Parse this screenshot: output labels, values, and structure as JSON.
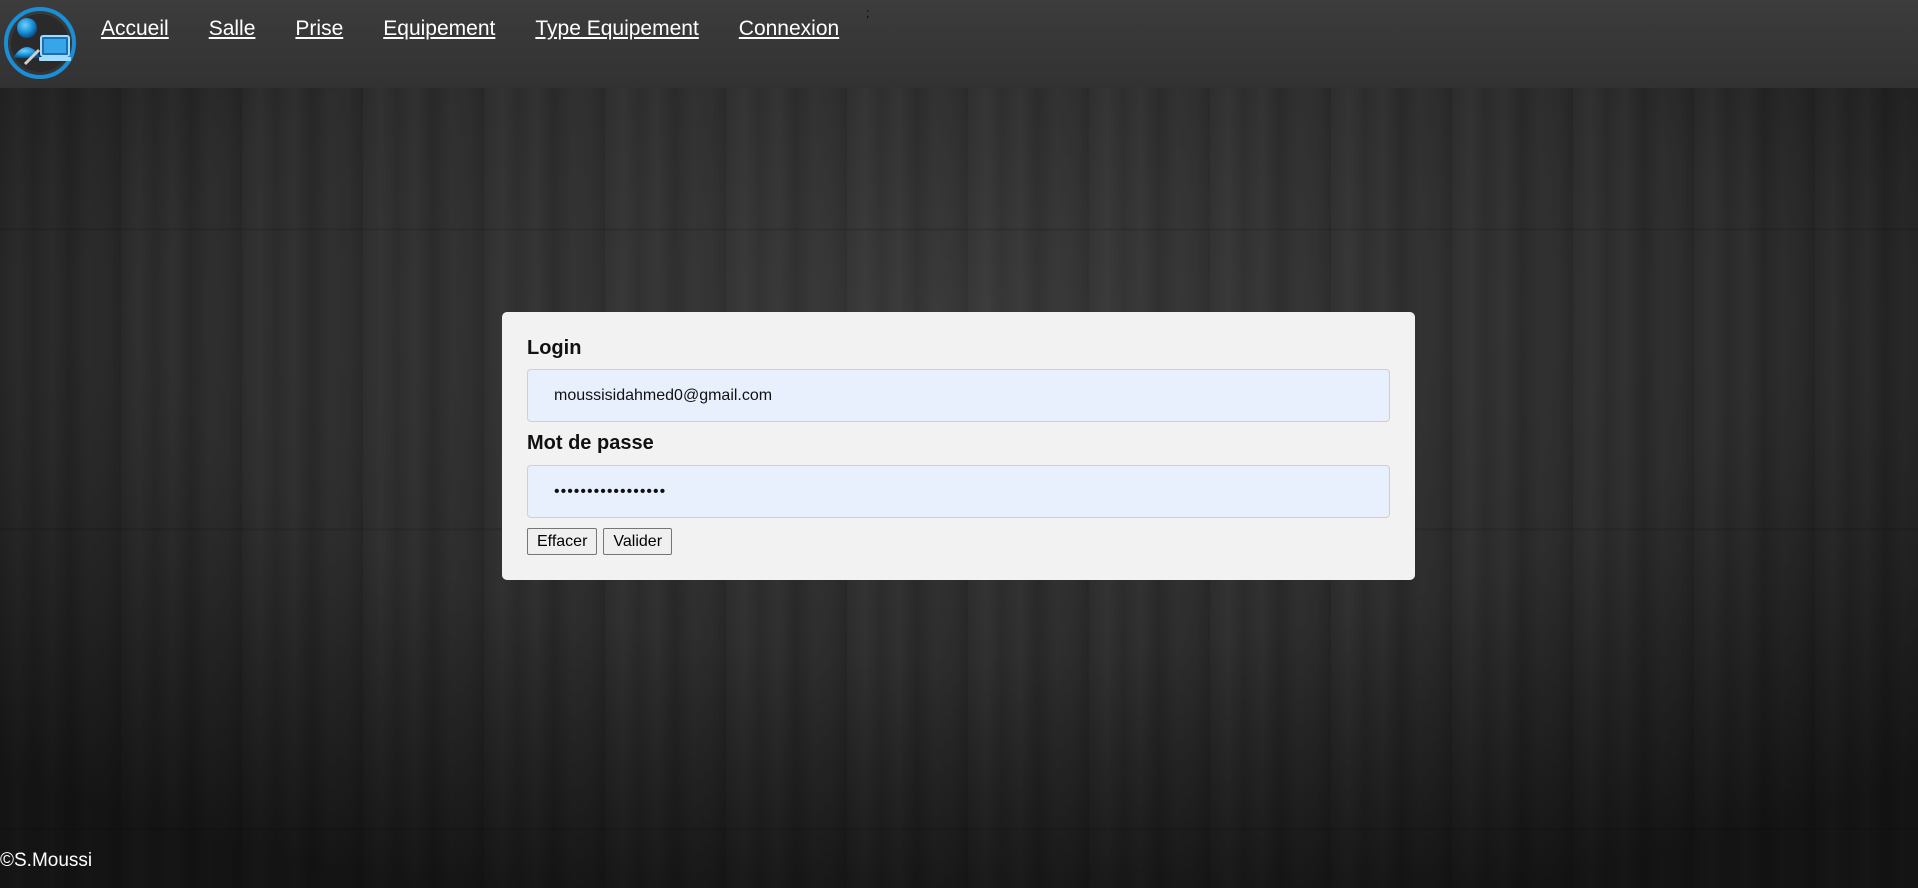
{
  "nav": {
    "links": [
      {
        "label": "Accueil"
      },
      {
        "label": "Salle"
      },
      {
        "label": "Prise"
      },
      {
        "label": "Equipement"
      },
      {
        "label": "Type Equipement"
      },
      {
        "label": "Connexion"
      }
    ],
    "stray_mark": ";"
  },
  "login_form": {
    "login_label": "Login",
    "login_value": "moussisidahmed0@gmail.com",
    "password_label": "Mot de passe",
    "password_value": "•••••••••••••••••",
    "clear_button": "Effacer",
    "submit_button": "Valider"
  },
  "footer": {
    "copyright": "©S.Moussi"
  },
  "colors": {
    "navbar": "#383838",
    "card_background": "#f2f2f2",
    "input_background": "#e8f0fe",
    "nav_link_text": "#ffffff"
  },
  "icons": {
    "logo": "logo-icon"
  }
}
